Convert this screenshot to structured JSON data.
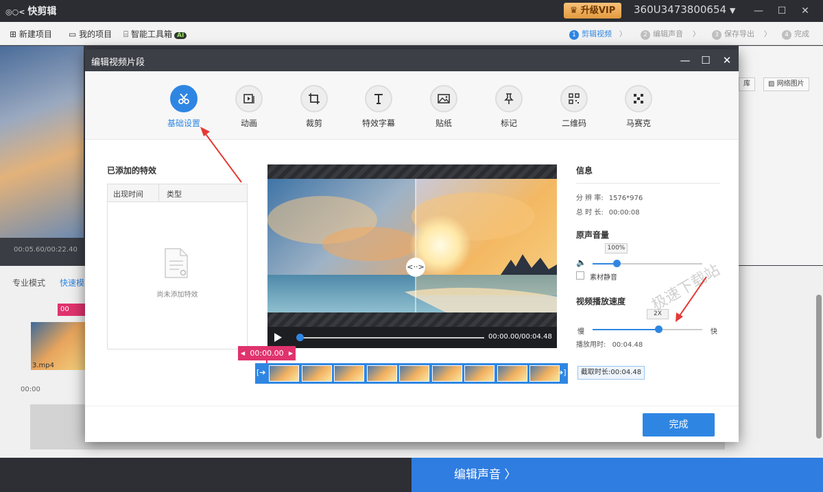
{
  "app": {
    "title": "快剪辑",
    "vip_label": "升级VIP",
    "user_id": "360U3473800654"
  },
  "toolbar": {
    "new_project": "新建项目",
    "my_projects": "我的项目",
    "smart_tools": "智能工具箱",
    "ai_badge": "AI"
  },
  "steps": [
    {
      "num": "1",
      "label": "剪辑视频",
      "active": true
    },
    {
      "num": "2",
      "label": "编辑声音",
      "active": false
    },
    {
      "num": "3",
      "label": "保存导出",
      "active": false
    },
    {
      "num": "4",
      "label": "完成",
      "active": false
    }
  ],
  "background": {
    "preview_time": "00:05.60/00:22.40",
    "mode_pro": "专业模式",
    "mode_fast": "快速模",
    "clip_name": "3.mp4",
    "zero_time": "00:00",
    "red_tag": "00",
    "right_btn_1": "库",
    "right_btn_2": "网络图片",
    "edit_audio_label": "编辑声音 〉"
  },
  "modal": {
    "title": "编辑视频片段",
    "tabs": [
      {
        "id": "basic",
        "label": "基础设置",
        "icon": "scissors-icon",
        "active": true
      },
      {
        "id": "animation",
        "label": "动画",
        "icon": "animation-icon",
        "active": false
      },
      {
        "id": "crop",
        "label": "裁剪",
        "icon": "crop-icon",
        "active": false
      },
      {
        "id": "subtitle",
        "label": "特效字幕",
        "icon": "text-icon",
        "active": false
      },
      {
        "id": "sticker",
        "label": "贴纸",
        "icon": "image-icon",
        "active": false
      },
      {
        "id": "mark",
        "label": "标记",
        "icon": "pin-icon",
        "active": false
      },
      {
        "id": "qrcode",
        "label": "二维码",
        "icon": "qrcode-icon",
        "active": false
      },
      {
        "id": "mosaic",
        "label": "马赛克",
        "icon": "mosaic-icon",
        "active": false
      }
    ],
    "effects": {
      "title": "已添加的特效",
      "col_time": "出现时间",
      "col_type": "类型",
      "empty": "尚未添加特效"
    },
    "video": {
      "time": "00:00.00/00:04.48",
      "start_tag": "00:00.00",
      "clip_duration": "截取时长:00:04.48",
      "progress": 0.0
    },
    "info": {
      "title": "信息",
      "resolution_label": "分 辨 率:",
      "resolution": "1576*976",
      "duration_label": "总 时 长:",
      "duration": "00:00:08"
    },
    "volume": {
      "title": "原声音量",
      "value": "100%",
      "level": 0.22,
      "mute_label": "素材静音"
    },
    "speed": {
      "title": "视频播放速度",
      "value": "2X",
      "level": 0.6,
      "slow_label": "慢",
      "fast_label": "快",
      "play_time_label": "播放用时:",
      "play_time": "00:04.48"
    },
    "done_label": "完成",
    "watermark": "极速下载站"
  },
  "colors": {
    "accent": "#2f86e2",
    "pink": "#e0336d",
    "annotation": "#e53935"
  }
}
